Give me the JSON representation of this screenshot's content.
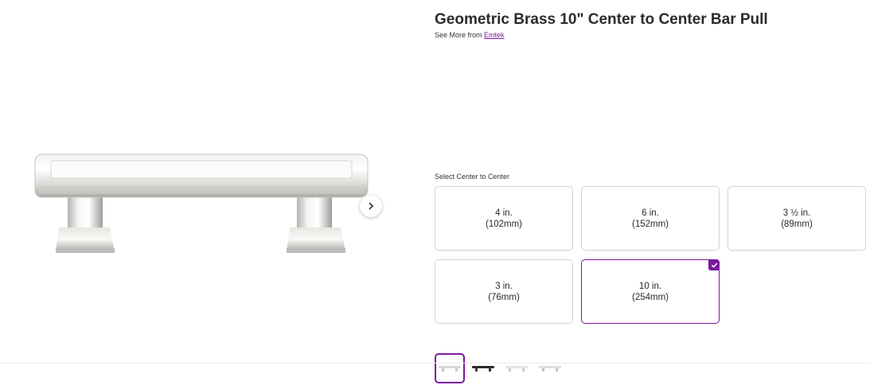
{
  "product": {
    "title": "Geometric Brass 10\" Center to Center Bar Pull",
    "see_more_prefix": "See More from",
    "brand": "Emtek"
  },
  "image": {
    "icon": "product-bar-pull-image",
    "next_icon": "chevron-right-icon"
  },
  "selector": {
    "label": "Select Center to Center",
    "options": [
      {
        "line1": "4 in.",
        "line2": "(102mm)"
      },
      {
        "line1": "6 in.",
        "line2": "(152mm)"
      },
      {
        "line1": "3 ½ in.",
        "line2": "(89mm)"
      },
      {
        "line1": "3 in.",
        "line2": "(76mm)"
      },
      {
        "line1": "10 in.",
        "line2": "(254mm)",
        "selected": true
      }
    ]
  },
  "thumbnails": [
    {
      "finish": "polished-nickel",
      "selected": true
    },
    {
      "finish": "oil-rubbed-bronze"
    },
    {
      "finish": "satin-nickel"
    },
    {
      "finish": "satin-nickel"
    }
  ],
  "colors": {
    "accent": "#7b189f",
    "border": "#d3d3d3",
    "text": "#2b2b2b"
  }
}
